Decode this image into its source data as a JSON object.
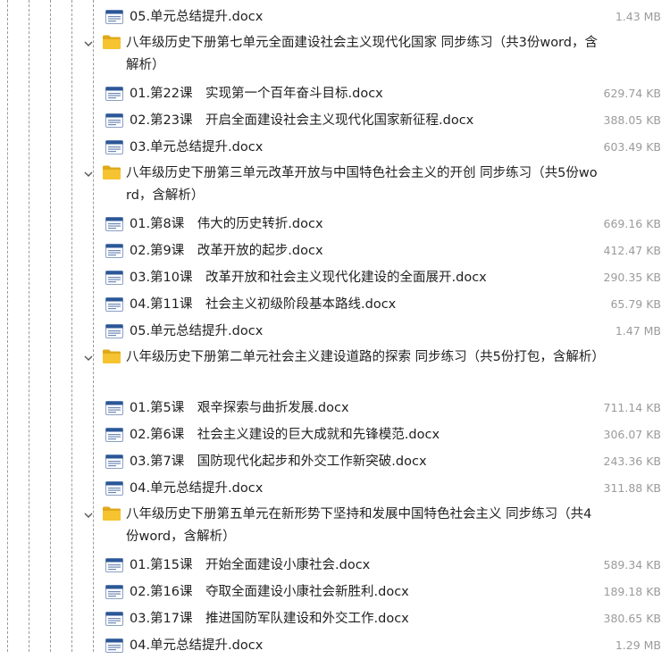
{
  "tree": [
    {
      "kind": "file",
      "name": "05.单元总结提升.docx",
      "size": "1.43 MB"
    },
    {
      "kind": "folder",
      "name": "八年级历史下册第七单元全面建设社会主义现代化国家 同步练习（共3份word，含解析）",
      "icon": "folder-icon"
    },
    {
      "kind": "file",
      "name": "01.第22课　实现第一个百年奋斗目标.docx",
      "size": "629.74 KB"
    },
    {
      "kind": "file",
      "name": "02.第23课　开启全面建设社会主义现代化国家新征程.docx",
      "size": "388.05 KB"
    },
    {
      "kind": "file",
      "name": "03.单元总结提升.docx",
      "size": "603.49 KB"
    },
    {
      "kind": "folder",
      "name": "八年级历史下册第三单元改革开放与中国特色社会主义的开创 同步练习（共5份word，含解析）",
      "icon": "folder-icon"
    },
    {
      "kind": "file",
      "name": "01.第8课　伟大的历史转折.docx",
      "size": "669.16 KB"
    },
    {
      "kind": "file",
      "name": "02.第9课　改革开放的起步.docx",
      "size": "412.47 KB"
    },
    {
      "kind": "file",
      "name": "03.第10课　改革开放和社会主义现代化建设的全面展开.docx",
      "size": "290.35 KB"
    },
    {
      "kind": "file",
      "name": "04.第11课　社会主义初级阶段基本路线.docx",
      "size": "65.79 KB"
    },
    {
      "kind": "file",
      "name": "05.单元总结提升.docx",
      "size": "1.47 MB"
    },
    {
      "kind": "folder",
      "name": "八年级历史下册第二单元社会主义建设道路的探索 同步练习（共5份打包，含解析）",
      "icon": "folder-icon"
    },
    {
      "kind": "file",
      "name": "01.第5课　艰辛探索与曲折发展.docx",
      "size": "711.14 KB"
    },
    {
      "kind": "file",
      "name": "02.第6课　社会主义建设的巨大成就和先锋模范.docx",
      "size": "306.07 KB"
    },
    {
      "kind": "file",
      "name": "03.第7课　国防现代化起步和外交工作新突破.docx",
      "size": "243.36 KB"
    },
    {
      "kind": "file",
      "name": "04.单元总结提升.docx",
      "size": "311.88 KB"
    },
    {
      "kind": "folder",
      "name": "八年级历史下册第五单元在新形势下坚持和发展中国特色社会主义 同步练习（共4份word，含解析）",
      "icon": "folder-icon"
    },
    {
      "kind": "file",
      "name": "01.第15课　开始全面建设小康社会.docx",
      "size": "589.34 KB"
    },
    {
      "kind": "file",
      "name": "02.第16课　夺取全面建设小康社会新胜利.docx",
      "size": "189.18 KB"
    },
    {
      "kind": "file",
      "name": "03.第17课　推进国防军队建设和外交工作.docx",
      "size": "380.65 KB"
    },
    {
      "kind": "file",
      "name": "04.单元总结提升.docx",
      "size": "1.29 MB"
    }
  ],
  "colors": {
    "folder": "#f5c430",
    "folder_dark": "#e0a81c",
    "doc_blue": "#2b5797",
    "size_text": "#9b9b9b"
  }
}
